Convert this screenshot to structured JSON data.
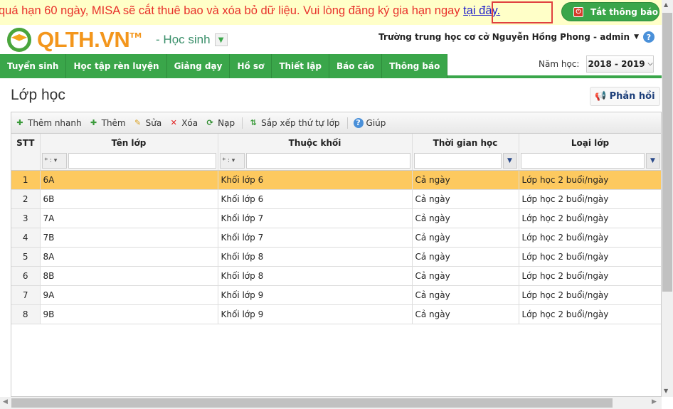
{
  "banner": {
    "message": "quá hạn 60 ngày, MISA sẽ cắt thuê bao và xóa bỏ dữ liệu. Vui lòng đăng ký gia hạn ngay ",
    "link": "tại đây.",
    "off_button": "Tắt thông báo"
  },
  "header": {
    "logo": "QLTH.VN",
    "tm": "TM",
    "role": "- Học sinh",
    "user": "Trường trung học cơ cở Nguyễn Hồng Phong - admin"
  },
  "nav": {
    "tabs": [
      "Tuyển sinh",
      "Học tập rèn luyện",
      "Giảng dạy",
      "Hồ sơ",
      "Thiết lập",
      "Báo cáo",
      "Thông báo"
    ],
    "year_label": "Năm học:",
    "year_value": "2018 - 2019"
  },
  "page": {
    "title": "Lớp học",
    "feedback": "Phản hồi"
  },
  "toolbar": {
    "quick_add": "Thêm nhanh",
    "add": "Thêm",
    "edit": "Sửa",
    "delete": "Xóa",
    "reload": "Nạp",
    "sort": "Sắp xếp thứ tự lớp",
    "help": "Giúp"
  },
  "grid": {
    "columns": [
      "STT",
      "Tên lớp",
      "Thuộc khối",
      "Thời gian học",
      "Loại lớp"
    ],
    "filter_op": "* :",
    "rows": [
      [
        "1",
        "6A",
        "Khối lớp 6",
        "Cả ngày",
        "Lớp học 2 buổi/ngày"
      ],
      [
        "2",
        "6B",
        "Khối lớp 6",
        "Cả ngày",
        "Lớp học 2 buổi/ngày"
      ],
      [
        "3",
        "7A",
        "Khối lớp 7",
        "Cả ngày",
        "Lớp học 2 buổi/ngày"
      ],
      [
        "4",
        "7B",
        "Khối lớp 7",
        "Cả ngày",
        "Lớp học 2 buổi/ngày"
      ],
      [
        "5",
        "8A",
        "Khối lớp 8",
        "Cả ngày",
        "Lớp học 2 buổi/ngày"
      ],
      [
        "6",
        "8B",
        "Khối lớp 8",
        "Cả ngày",
        "Lớp học 2 buổi/ngày"
      ],
      [
        "7",
        "9A",
        "Khối lớp 9",
        "Cả ngày",
        "Lớp học 2 buổi/ngày"
      ],
      [
        "8",
        "9B",
        "Khối lớp 9",
        "Cả ngày",
        "Lớp học 2 buổi/ngày"
      ]
    ],
    "selected_row": 0
  }
}
